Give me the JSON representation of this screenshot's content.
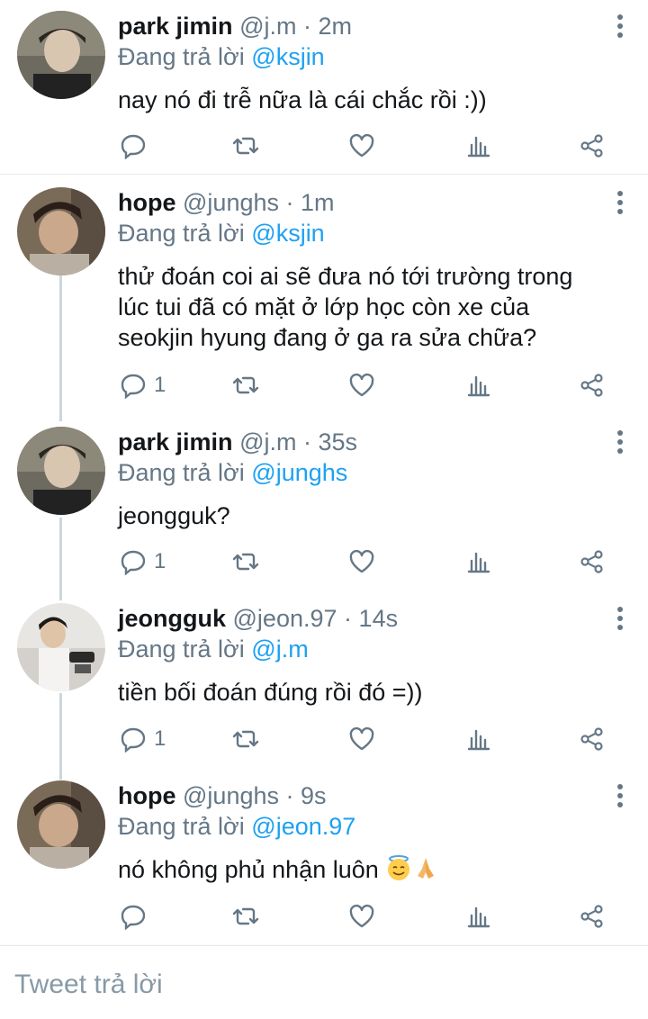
{
  "reply_prefix": "Đang trả lời",
  "tweets": [
    {
      "name": "park jimin",
      "handle": "@j.m",
      "time": "2m",
      "reply_to": "@ksjin",
      "text": "nay nó đi trễ nữa là cái chắc rồi :))",
      "reply_count": ""
    },
    {
      "name": "hope",
      "handle": "@junghs",
      "time": "1m",
      "reply_to": "@ksjin",
      "text_lines": [
        "thử đoán coi ai sẽ đưa nó tới trường trong",
        "lúc tui đã có mặt ở lớp học còn xe của",
        "seokjin hyung đang ở ga ra sửa chữa?"
      ],
      "reply_count": "1"
    },
    {
      "name": "park jimin",
      "handle": "@j.m",
      "time": "35s",
      "reply_to": "@junghs",
      "text": "jeongguk?",
      "reply_count": "1"
    },
    {
      "name": "jeongguk",
      "handle": "@jeon.97",
      "time": "14s",
      "reply_to": "@j.m",
      "text": "tiền bối đoán đúng rồi đó =))",
      "reply_count": "1"
    },
    {
      "name": "hope",
      "handle": "@junghs",
      "time": "9s",
      "reply_to": "@jeon.97",
      "text": "nó không phủ nhận luôn",
      "emojis": [
        "smiling-face-with-halo",
        "folded-hands"
      ],
      "reply_count": ""
    }
  ],
  "separator": "·",
  "compose": {
    "placeholder": "Tweet trả lời"
  },
  "colors": {
    "accent": "#1da1f2",
    "muted": "#657786",
    "text": "#14171a",
    "line": "#ccd6dd"
  }
}
